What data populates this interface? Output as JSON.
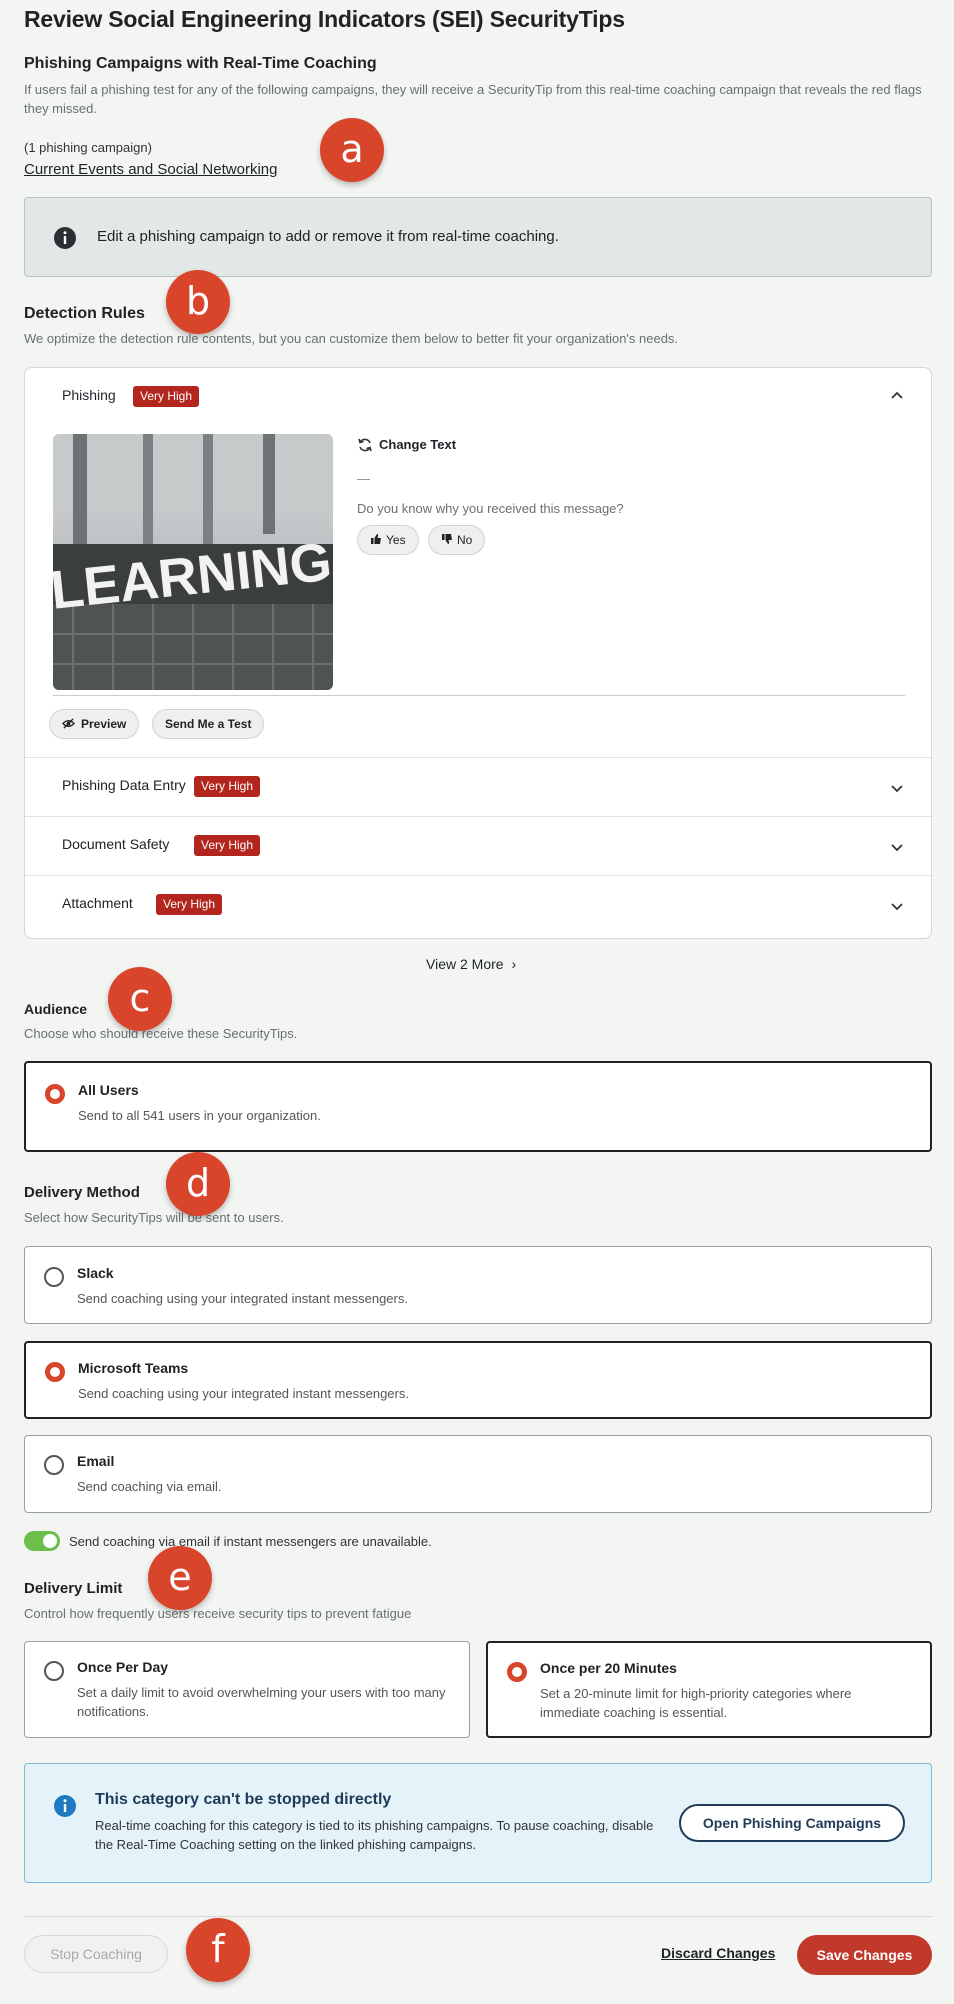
{
  "page": {
    "title": "Review Social Engineering Indicators (SEI) SecurityTips"
  },
  "phishing_campaigns": {
    "heading": "Phishing Campaigns with Real-Time Coaching",
    "description": "If users fail a phishing test for any of the following campaigns, they will receive a SecurityTip from this real-time coaching campaign that reveals the red flags they missed.",
    "count_label": "(1 phishing campaign)",
    "campaign_link": "Current Events and Social Networking",
    "info_text": "Edit a phishing campaign to add or remove it from real-time coaching."
  },
  "detection_rules": {
    "heading": "Detection Rules",
    "description": "We optimize the detection rule contents, but you can customize them below to better fit your organization's needs.",
    "expanded": {
      "name": "Phishing",
      "badge": "Very High",
      "image_text": "LEARNING",
      "change_text": "Change Text",
      "dash": "—",
      "question": "Do you know why you received this message?",
      "yes": "Yes",
      "no": "No",
      "preview": "Preview",
      "send_test": "Send Me a Test"
    },
    "collapsed": [
      {
        "name": "Phishing Data Entry",
        "badge": "Very High"
      },
      {
        "name": "Document Safety",
        "badge": "Very High"
      },
      {
        "name": "Attachment",
        "badge": "Very High"
      }
    ],
    "view_more": "View 2 More"
  },
  "audience": {
    "heading": "Audience",
    "description": "Choose who should receive these SecurityTips.",
    "option_label": "All Users",
    "option_desc": "Send to all 541 users in your organization."
  },
  "delivery_method": {
    "heading": "Delivery Method",
    "description": "Select how SecurityTips will be sent to users.",
    "options": [
      {
        "label": "Slack",
        "desc": "Send coaching using your integrated instant messengers."
      },
      {
        "label": "Microsoft Teams",
        "desc": "Send coaching using your integrated instant messengers."
      },
      {
        "label": "Email",
        "desc": "Send coaching via email."
      }
    ],
    "fallback_toggle": "Send coaching via email if instant messengers are unavailable."
  },
  "delivery_limit": {
    "heading": "Delivery Limit",
    "description": "Control how frequently users receive security tips to prevent fatigue",
    "options": [
      {
        "label": "Once Per Day",
        "desc": "Set a daily limit to avoid overwhelming your users with too many notifications."
      },
      {
        "label": "Once per 20 Minutes",
        "desc": "Set a 20-minute limit for high-priority categories where immediate coaching is essential."
      }
    ]
  },
  "alert": {
    "title": "This category can't be stopped directly",
    "body": "Real-time coaching for this category is tied to its phishing campaigns. To pause coaching, disable the Real-Time Coaching setting on the linked phishing campaigns.",
    "button": "Open Phishing Campaigns"
  },
  "footer": {
    "stop": "Stop Coaching",
    "discard": "Discard Changes",
    "save": "Save Changes"
  },
  "markers": [
    "a",
    "b",
    "c",
    "d",
    "e",
    "f"
  ],
  "colors": {
    "accent_red": "#c0392b",
    "badge_red": "#b3261e",
    "radio_on": "#d9442b",
    "toggle_green": "#6bbf4a",
    "alert_bg": "#e4f3fa"
  }
}
